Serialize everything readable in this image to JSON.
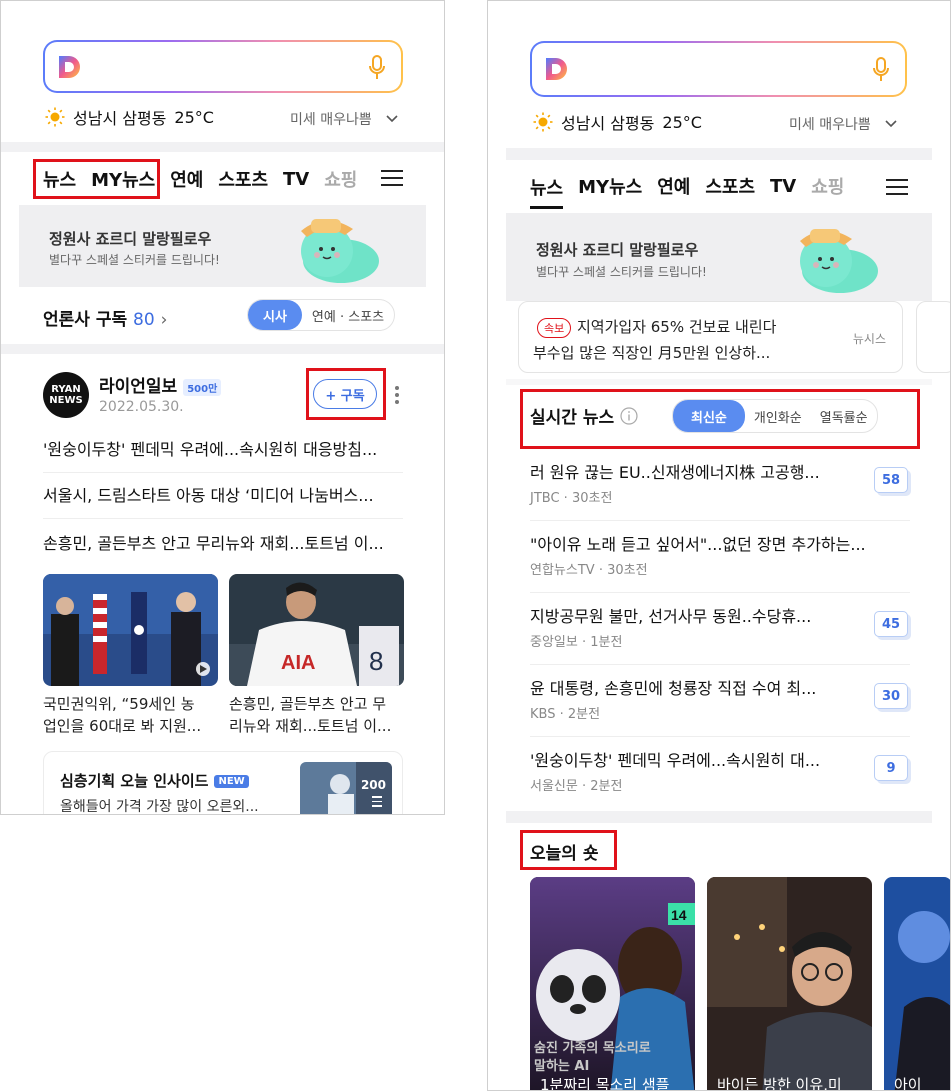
{
  "left": {
    "weather": {
      "location": "성남시 삼평동",
      "temperature": "25°C",
      "air": "미세 매우나쁨"
    },
    "tabs": [
      "뉴스",
      "MY뉴스",
      "연예",
      "스포츠",
      "TV",
      "쇼핑",
      "E"
    ],
    "banner": {
      "title": "정원사 죠르디 말랑필로우",
      "subtitle": "별다꾸 스페셜 스티커를 드립니다!"
    },
    "press": {
      "label": "언론사 구독",
      "count": "80",
      "arrow": "›",
      "seg_on": "시사",
      "seg_off": "연예 · 스포츠"
    },
    "brand": {
      "logo_line1": "RYAN",
      "logo_line2": "NEWS",
      "name": "라이언일보",
      "badge": "500만",
      "date": "2022.05.30.",
      "subscribe": "+ 구독"
    },
    "headlines": [
      "'원숭이두창' 펜데믹 우려에...속시원히 대응방침...",
      "서울시, 드림스타트 아동 대상 ‘미디어 나눔버스...",
      "손흥민, 골든부츠 안고 무리뉴와 재회...토트넘 이..."
    ],
    "photos": [
      {
        "caption1": "국민권익위, “59세인 농",
        "caption2": "업인을 60대로 봐 지원..."
      },
      {
        "caption1": "손흥민, 골든부츠 안고 무",
        "caption2": "리뉴와 재회...토트넘 이..."
      }
    ],
    "feature": {
      "title": "심층기획 오늘 인사이드",
      "badge": "NEW",
      "subtitle": "올해들어 가격 가장 많이 오른외...",
      "count": "200"
    }
  },
  "right": {
    "weather": {
      "location": "성남시 삼평동",
      "temperature": "25°C",
      "air": "미세 매우나쁨"
    },
    "tabs": [
      "뉴스",
      "MY뉴스",
      "연예",
      "스포츠",
      "TV",
      "쇼핑",
      "E"
    ],
    "banner": {
      "title": "정원사 죠르디 말랑필로우",
      "subtitle": "별다꾸 스페셜 스티커를 드립니다!"
    },
    "breaking": {
      "tag": "속보",
      "line1": "지역가입자 65% 건보료 내린다",
      "line2": "부수입 많은 직장인 月5만원 인상하...",
      "source": "뉴시스"
    },
    "realtime": {
      "label": "실시간 뉴스",
      "sorts": [
        "최신순",
        "개인화순",
        "열독률순"
      ]
    },
    "news": [
      {
        "title": "러 원유 끊는 EU..신재생에너지株 고공행...",
        "source": "JTBC",
        "time": "30초전",
        "comments": "58"
      },
      {
        "title": "\"아이유 노래 듣고 싶어서\"...없던 장면 추가하는...",
        "source": "연합뉴스TV",
        "time": "30초전",
        "comments": ""
      },
      {
        "title": "지방공무원 불만, 선거사무 동원..수당휴...",
        "source": "중앙일보",
        "time": "1분전",
        "comments": "45"
      },
      {
        "title": "윤 대통령, 손흥민에 청룡장 직접 수여 최...",
        "source": "KBS",
        "time": "2분전",
        "comments": "30"
      },
      {
        "title": "'원숭이두창' 펜데믹 우려에...속시원히 대...",
        "source": "서울신문",
        "time": "2분전",
        "comments": "9"
      }
    ],
    "shots": {
      "label": "오늘의 숏",
      "items": [
        {
          "overlay1": "숨진 가족의 목소리로",
          "overlay2": "말하는 AI",
          "caption": "1분짜리 목소리 샘플",
          "tag": "14"
        },
        {
          "caption": "바이든 방한 이유,미"
        },
        {
          "caption": "아이"
        }
      ]
    }
  }
}
